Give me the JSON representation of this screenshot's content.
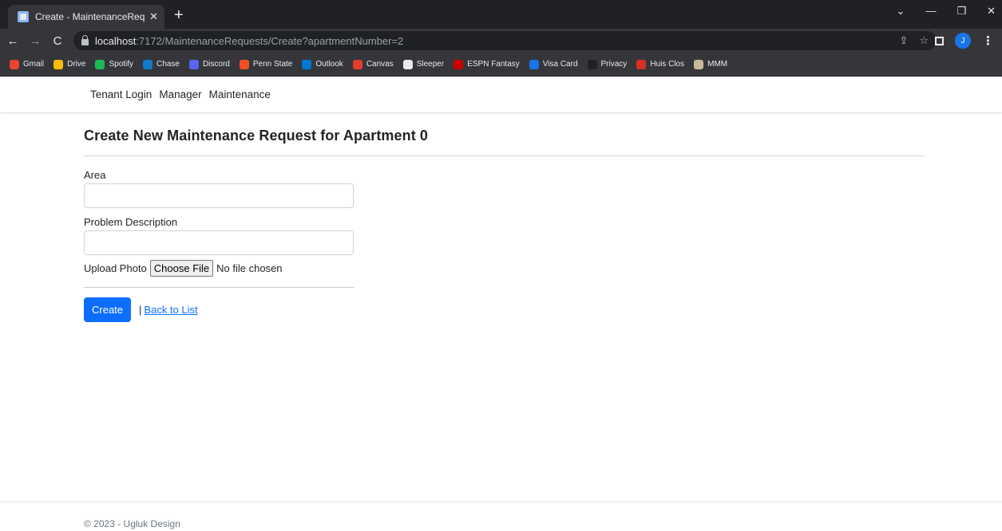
{
  "browser": {
    "tab_title": "Create - MaintenanceRequestAp",
    "tab_close": "✕",
    "new_tab": "+",
    "window_controls": {
      "minimize": "—",
      "restore": "❐",
      "close": "✕",
      "dropdown": "⌄"
    },
    "nav": {
      "back": "←",
      "forward": "→",
      "reload": "C"
    },
    "url_host": "localhost",
    "url_rest": ":7172/MaintenanceRequests/Create?apartmentNumber=2",
    "omnibox_actions": {
      "share": "⇪",
      "star": "☆"
    },
    "profile_initial": "J",
    "menu": "⋮",
    "bookmarks": [
      {
        "label": "Gmail",
        "color": "#ea4335"
      },
      {
        "label": "Drive",
        "color": "#fbbc04"
      },
      {
        "label": "Spotify",
        "color": "#1db954"
      },
      {
        "label": "Chase",
        "color": "#117aca"
      },
      {
        "label": "Discord",
        "color": "#5865f2"
      },
      {
        "label": "Penn State",
        "color": "#f25022"
      },
      {
        "label": "Outlook",
        "color": "#0078d4"
      },
      {
        "label": "Canvas",
        "color": "#e13f2b"
      },
      {
        "label": "Sleeper",
        "color": "#e8eaed"
      },
      {
        "label": "ESPN Fantasy",
        "color": "#cc0000"
      },
      {
        "label": "Visa Card",
        "color": "#1a73e8"
      },
      {
        "label": "Privacy",
        "color": "#202124"
      },
      {
        "label": "Huis Clos",
        "color": "#d93025"
      },
      {
        "label": "MMM",
        "color": "#c9b99a"
      }
    ]
  },
  "navbar": {
    "links": [
      "Tenant Login",
      "Manager",
      "Maintenance"
    ]
  },
  "main": {
    "title": "Create New Maintenance Request for Apartment 0",
    "fields": {
      "area_label": "Area",
      "area_value": "",
      "problem_label": "Problem Description",
      "problem_value": "",
      "upload_label": "Upload Photo",
      "choose_file": "Choose File",
      "no_file": "No file chosen"
    },
    "actions": {
      "create": "Create",
      "separator": "|",
      "back_to_list": "Back to List"
    }
  },
  "footer": {
    "text": "© 2023 - Ugluk Design"
  },
  "colors": {
    "primary": "#0d6efd",
    "chrome_dark": "#202124",
    "chrome_toolbar": "#35363a"
  }
}
